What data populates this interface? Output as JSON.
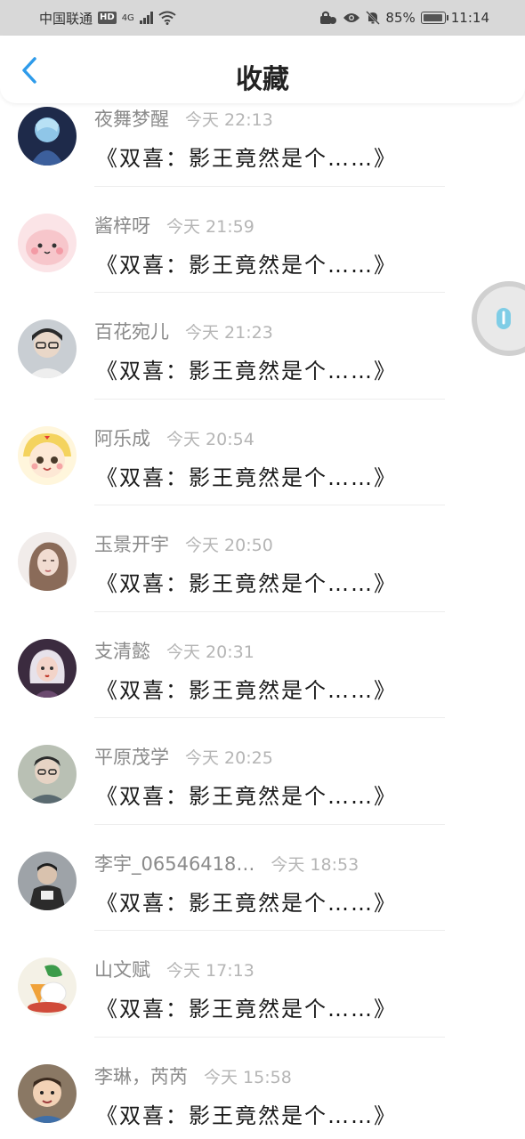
{
  "status_bar": {
    "carrier": "中国联通",
    "hd": "HD",
    "network": "4G",
    "battery": "85%",
    "time": "11:14"
  },
  "header": {
    "title": "收藏"
  },
  "items": [
    {
      "author": "夜舞梦醒",
      "time": "今天 22:13",
      "message": "《双喜：影王竟然是个……》"
    },
    {
      "author": "酱梓呀",
      "time": "今天 21:59",
      "message": "《双喜：影王竟然是个……》"
    },
    {
      "author": "百花宛儿",
      "time": "今天 21:23",
      "message": "《双喜：影王竟然是个……》"
    },
    {
      "author": "阿乐成",
      "time": "今天 20:54",
      "message": "《双喜：影王竟然是个……》"
    },
    {
      "author": "玉景开宇",
      "time": "今天 20:50",
      "message": "《双喜：影王竟然是个……》"
    },
    {
      "author": "支清懿",
      "time": "今天 20:31",
      "message": "《双喜：影王竟然是个……》"
    },
    {
      "author": "平原茂学",
      "time": "今天 20:25",
      "message": "《双喜：影王竟然是个……》"
    },
    {
      "author": "李宇_06546418…",
      "time": "今天 18:53",
      "message": "《双喜：影王竟然是个……》"
    },
    {
      "author": "山文赋",
      "time": "今天 17:13",
      "message": "《双喜：影王竟然是个……》"
    },
    {
      "author": "李琳，芮芮",
      "time": "今天 15:58",
      "message": "《双喜：影王竟然是个……》"
    }
  ],
  "colors": {
    "accent": "#2e9bea",
    "status_bar_bg": "#d8d8d8",
    "author_text": "#8a8a8a",
    "time_text": "#b5b5b5"
  }
}
